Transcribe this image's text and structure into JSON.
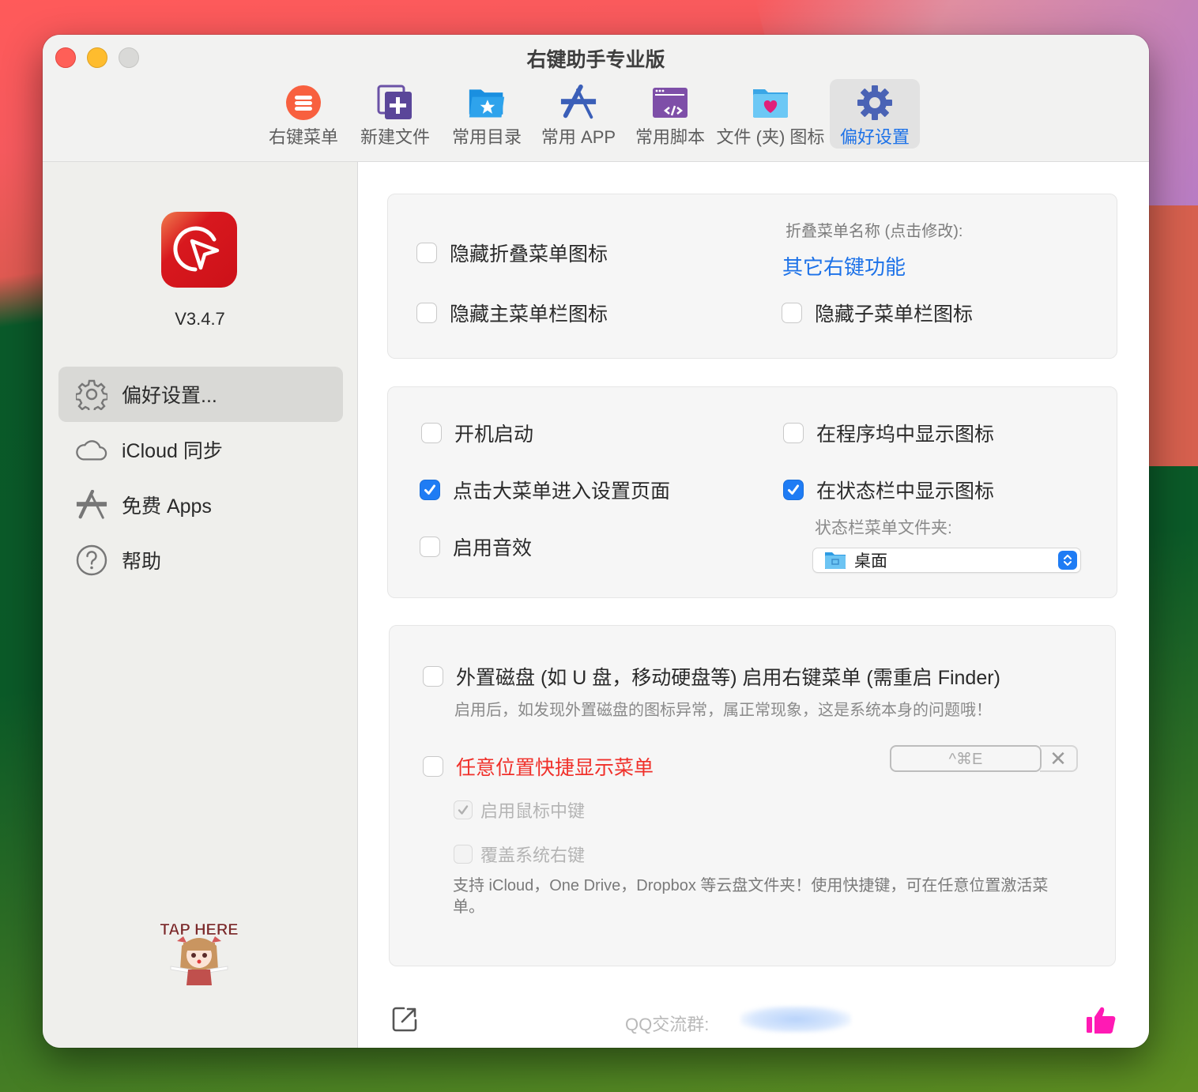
{
  "window": {
    "title": "右键助手专业版"
  },
  "toolbar": {
    "items": [
      {
        "label": "右键菜单",
        "icon": "menu-list-icon",
        "active": false
      },
      {
        "label": "新建文件",
        "icon": "new-file-icon",
        "active": false
      },
      {
        "label": "常用目录",
        "icon": "favorite-folder-icon",
        "active": false
      },
      {
        "label": "常用 APP",
        "icon": "app-store-icon",
        "active": false
      },
      {
        "label": "常用脚本",
        "icon": "script-icon",
        "active": false
      },
      {
        "label": "文件 (夹) 图标",
        "icon": "folder-heart-icon",
        "active": false
      },
      {
        "label": "偏好设置",
        "icon": "gear-icon",
        "active": true
      }
    ]
  },
  "sidebar": {
    "version": "V3.4.7",
    "items": [
      {
        "label": "偏好设置...",
        "icon": "gear-icon",
        "active": true
      },
      {
        "label": "iCloud 同步",
        "icon": "cloud-icon",
        "active": false
      },
      {
        "label": "免费 Apps",
        "icon": "app-store-icon",
        "active": false
      },
      {
        "label": "帮助",
        "icon": "help-icon",
        "active": false
      }
    ],
    "mascot_text": "TAP HERE"
  },
  "card1": {
    "hide_fold_icon": {
      "label": "隐藏折叠菜单图标",
      "checked": false
    },
    "hide_main_icon": {
      "label": "隐藏主菜单栏图标",
      "checked": false
    },
    "hide_sub_icon": {
      "label": "隐藏子菜单栏图标",
      "checked": false
    },
    "fold_name_label": "折叠菜单名称 (点击修改):",
    "fold_name_value": "其它右键功能"
  },
  "card2": {
    "launch_at_login": {
      "label": "开机启动",
      "checked": false
    },
    "click_to_settings": {
      "label": "点击大菜单进入设置页面",
      "checked": true
    },
    "sound": {
      "label": "启用音效",
      "checked": false
    },
    "show_in_dock": {
      "label": "在程序坞中显示图标",
      "checked": false
    },
    "show_in_statusbar": {
      "label": "在状态栏中显示图标",
      "checked": true
    },
    "statusbar_folder_label": "状态栏菜单文件夹:",
    "statusbar_folder_value": "桌面"
  },
  "card3": {
    "external_disk": {
      "label": "外置磁盘 (如 U 盘，移动硬盘等) 启用右键菜单 (需重启 Finder)",
      "checked": false
    },
    "external_disk_note": "启用后，如发现外置磁盘的图标异常，属正常现象，这是系统本身的问题哦！",
    "anywhere_menu": {
      "label": "任意位置快捷显示菜单",
      "checked": false
    },
    "shortcut_value": "^⌘E",
    "shortcut_clear": "✕",
    "middle_click": {
      "label": "启用鼠标中键",
      "checked": true,
      "disabled": true
    },
    "override_right_click": {
      "label": "覆盖系统右键",
      "checked": false,
      "disabled": true
    },
    "note": "支持 iCloud，One Drive，Dropbox 等云盘文件夹！使用快捷键，可在任意位置激活菜单。"
  },
  "footer": {
    "qq_label": "QQ交流群:",
    "qq_value": "•••••••••",
    "colors": {
      "thumb": "#ff1ab4"
    }
  },
  "colors": {
    "accent": "#1d72e8",
    "warning": "#f0302a",
    "close": "#ff5f57",
    "minimize": "#febc2e",
    "zoom": "#d9d9d7"
  }
}
